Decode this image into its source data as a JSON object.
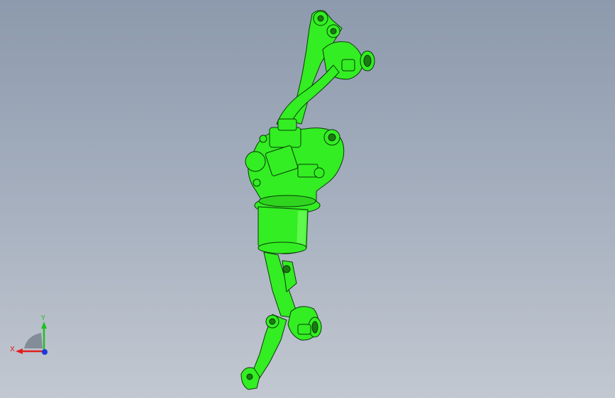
{
  "viewport": {
    "background_top": "#8d9aad",
    "background_bottom": "#c2c8d1"
  },
  "model": {
    "name": "wiper-linkage-assembly",
    "fill_color": "#33ee22",
    "edge_color": "#0a3a0a"
  },
  "triad": {
    "x_label": "X",
    "y_label": "Y",
    "x_color": "#e02020",
    "y_color": "#20c020",
    "z_color": "#1a3adb"
  }
}
